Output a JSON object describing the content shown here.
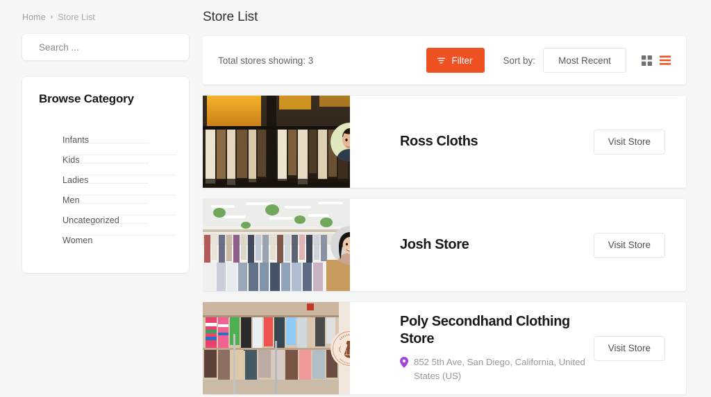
{
  "breadcrumb": {
    "home_label": "Home",
    "separator": "›",
    "current_label": "Store List"
  },
  "search": {
    "placeholder": "Search ...",
    "value": ""
  },
  "sidebar": {
    "category_title": "Browse Category",
    "categories": [
      {
        "label": "Infants"
      },
      {
        "label": "Kids"
      },
      {
        "label": "Ladies"
      },
      {
        "label": "Men"
      },
      {
        "label": "Uncategorized"
      },
      {
        "label": "Women"
      }
    ]
  },
  "header": {
    "title": "Store List"
  },
  "toolbar": {
    "total_text": "Total stores showing: 3",
    "filter_label": "Filter",
    "filter_icon": "filter-funnel-icon",
    "filter_color": "#f05123",
    "sort_label": "Sort by:",
    "sort_value": "Most Recent",
    "sort_options": [
      "Most Recent"
    ],
    "grid_view_icon": "grid-view-icon",
    "list_view_icon": "list-view-icon",
    "active_view": "list",
    "active_view_color": "#f05123",
    "inactive_view_color": "#6e7277"
  },
  "stores": [
    {
      "name": "Ross Cloths",
      "address": "",
      "visit_label": "Visit Store",
      "avatar_name": "store-avatar-ross-cloths",
      "avatar_bg": "#dfe8bf",
      "banner_name": "store-banner-ross-cloths"
    },
    {
      "name": "Josh Store",
      "address": "",
      "visit_label": "Visit Store",
      "avatar_name": "store-avatar-josh-store",
      "avatar_bg": "#d8d8d8",
      "banner_name": "store-banner-josh-store"
    },
    {
      "name": "Poly Secondhand Clothing Store",
      "address": "852 5th Ave, San Diego, California, United States (US)",
      "visit_label": "Visit Store",
      "avatar_name": "store-logo-poly-secondhand",
      "avatar_bg": "#f6e7dc",
      "banner_name": "store-banner-poly-secondhand",
      "pin_icon": "location-pin-icon",
      "pin_color": "#a545d8"
    }
  ]
}
